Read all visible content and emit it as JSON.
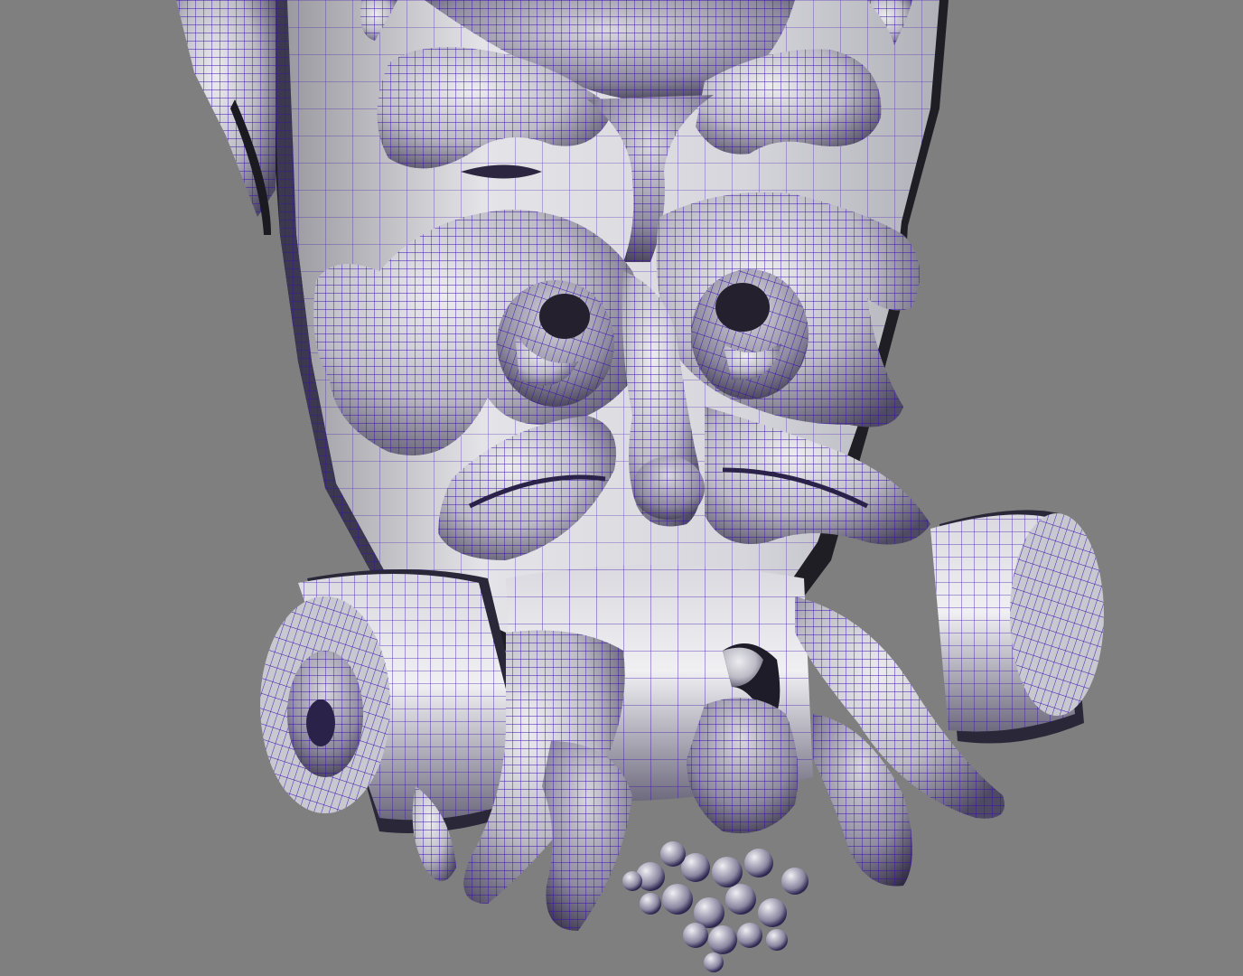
{
  "viewport": {
    "background_color": "#7f7f7f",
    "wire_color": "#3a0fb0",
    "surface_light": "#e6e6ea",
    "surface_mid": "#b9b9c2",
    "surface_dark": "#5d5a6a",
    "shadow_color": "#1c1c22"
  },
  "model": {
    "subject": "carved-corbel-bracket-wireframe-mesh",
    "parts": [
      "back-plate",
      "top-medallion",
      "upper-acanthus-leaves",
      "left-scroll-volute",
      "right-scroll-volute",
      "center-face-ridge",
      "hanging-acanthus-leaves",
      "bottom-left-scroll",
      "bottom-right-scroll",
      "grape-cluster"
    ]
  }
}
